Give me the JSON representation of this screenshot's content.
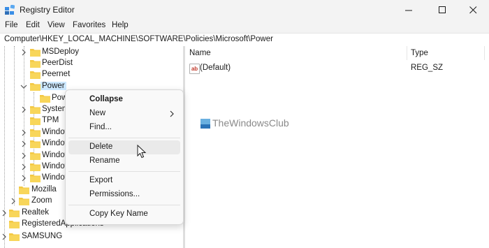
{
  "window": {
    "title": "Registry Editor",
    "minimize_icon": "minimize-icon",
    "maximize_icon": "maximize-icon",
    "close_icon": "close-icon"
  },
  "menu": [
    "File",
    "Edit",
    "View",
    "Favorites",
    "Help"
  ],
  "address": "Computer\\HKEY_LOCAL_MACHINE\\SOFTWARE\\Policies\\Microsoft\\Power",
  "tree": {
    "items": [
      {
        "label": "MSDeploy",
        "expanded": false
      },
      {
        "label": "PeerDist",
        "expanded": false
      },
      {
        "label": "Peernet",
        "expanded": false
      },
      {
        "label": "Power",
        "expanded": true,
        "selected": true
      },
      {
        "label": "Pow",
        "expanded": false
      },
      {
        "label": "System",
        "expanded": false
      },
      {
        "label": "TPM",
        "expanded": false
      },
      {
        "label": "Window",
        "expanded": false
      },
      {
        "label": "Window",
        "expanded": false
      },
      {
        "label": "Window",
        "expanded": false
      },
      {
        "label": "Window",
        "expanded": false
      },
      {
        "label": "Window",
        "expanded": false
      },
      {
        "label": "Mozilla",
        "expanded": false
      },
      {
        "label": "Zoom",
        "expanded": false
      },
      {
        "label": "Realtek",
        "expanded": false
      },
      {
        "label": "RegisteredApplications",
        "expanded": false
      },
      {
        "label": "SAMSUNG",
        "expanded": false
      }
    ]
  },
  "values_pane": {
    "columns": [
      "Name",
      "Type"
    ],
    "rows": [
      {
        "icon": "ab",
        "name": "(Default)",
        "type": "REG_SZ"
      }
    ]
  },
  "watermark": "TheWindowsClub",
  "context_menu": {
    "items": [
      {
        "label": "Collapse",
        "bold": true
      },
      {
        "label": "New",
        "submenu": true
      },
      {
        "label": "Find..."
      },
      {
        "label": "Delete",
        "hover": true
      },
      {
        "label": "Rename"
      },
      {
        "label": "Export"
      },
      {
        "label": "Permissions..."
      },
      {
        "label": "Copy Key Name"
      }
    ]
  },
  "colors": {
    "selection": "#cce8ff",
    "folder": "#f3c843",
    "chrome": "#f3f3f3"
  }
}
